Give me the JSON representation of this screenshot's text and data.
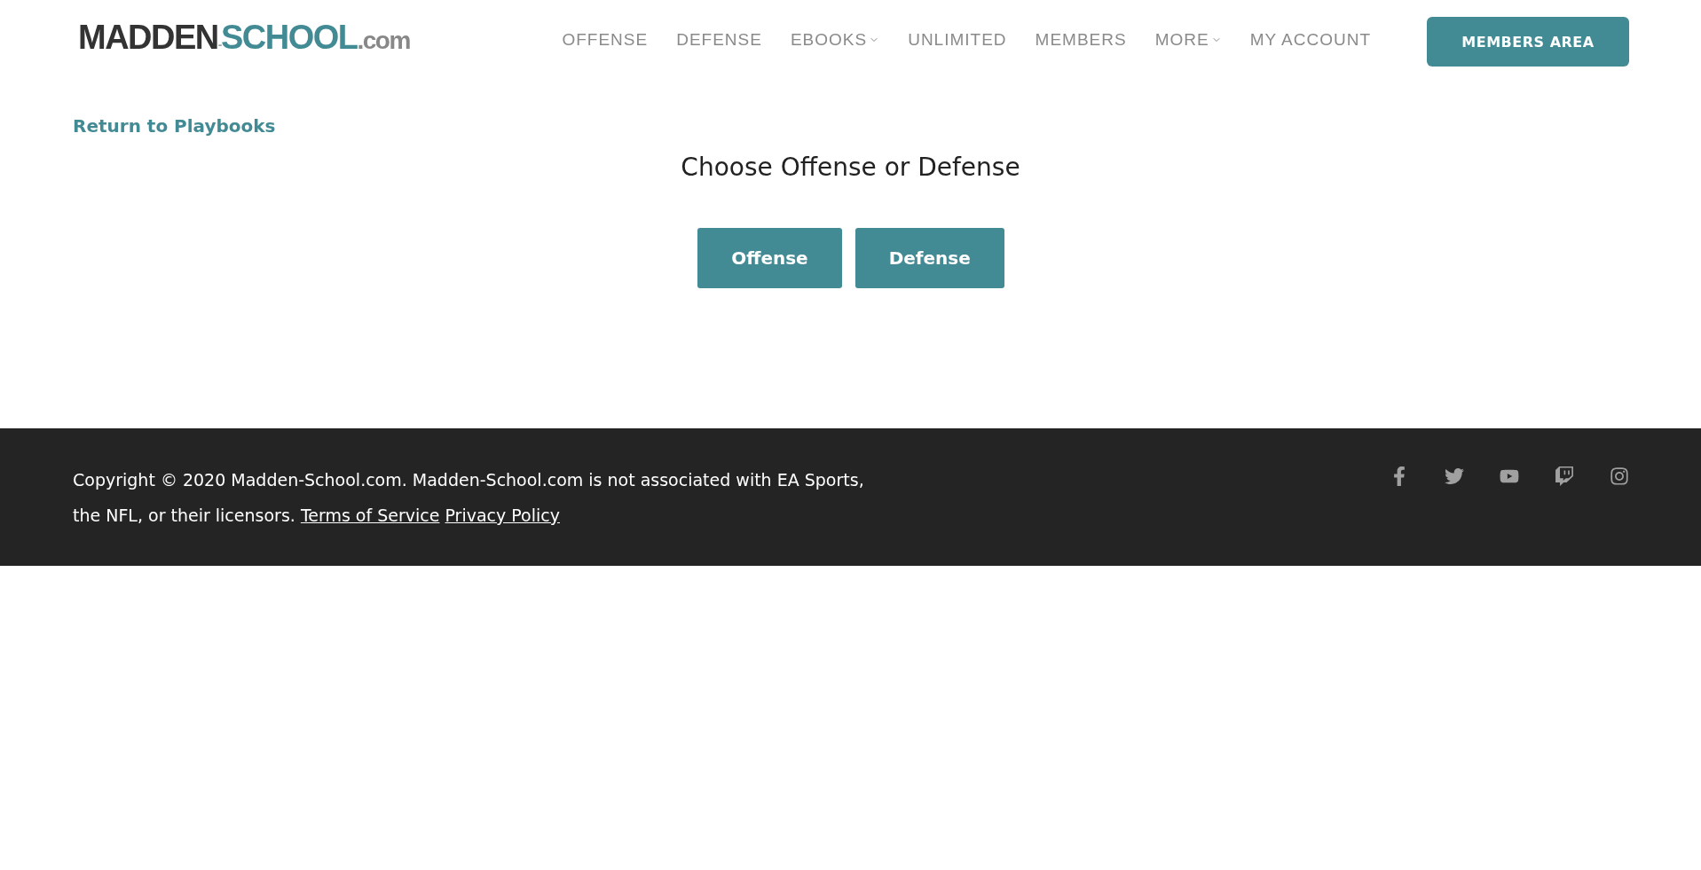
{
  "header": {
    "logo": {
      "parts": [
        "MADDEN",
        "-",
        "SCHOOL",
        ".com"
      ]
    },
    "nav": [
      {
        "label": "OFFENSE",
        "dropdown": false
      },
      {
        "label": "DEFENSE",
        "dropdown": false
      },
      {
        "label": "EBOOKS",
        "dropdown": true
      },
      {
        "label": "UNLIMITED",
        "dropdown": false
      },
      {
        "label": "MEMBERS",
        "dropdown": false
      },
      {
        "label": "MORE",
        "dropdown": true
      },
      {
        "label": "MY ACCOUNT",
        "dropdown": false
      }
    ],
    "cta": "MEMBERS AREA"
  },
  "back_link": "Return to Playbooks",
  "title": "Choose Offense or Defense",
  "buttons": [
    "Offense",
    "Defense"
  ],
  "footer": {
    "text": "Copyright © 2020 Madden-School.com. Madden-School.com is not associated with EA Sports, the NFL, or their licensors.",
    "links": [
      "Terms of Service",
      "Privacy Policy"
    ]
  }
}
